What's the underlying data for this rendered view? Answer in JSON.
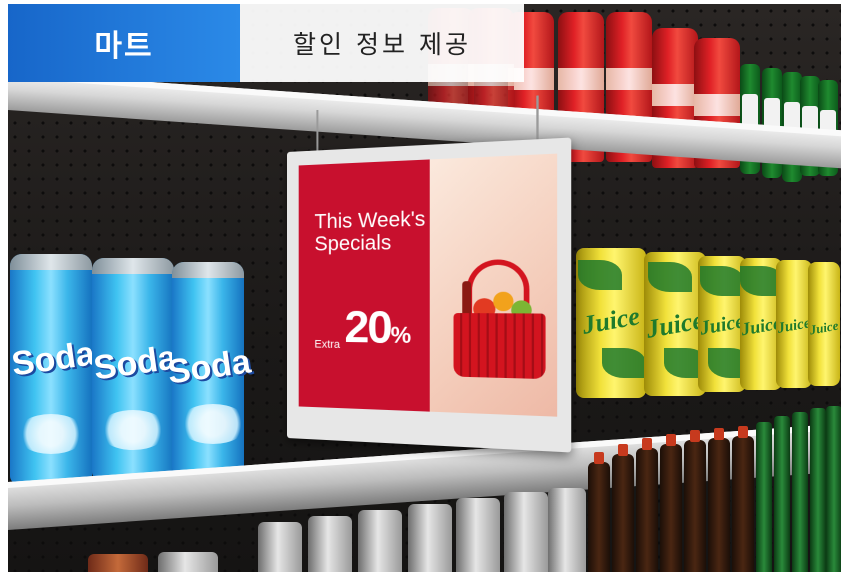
{
  "header": {
    "category_label": "마트",
    "title": "할인 정보 제공"
  },
  "signage": {
    "headline_line1": "This Week's",
    "headline_line2": "Specials",
    "extra_label": "Extra",
    "discount_value": "20",
    "discount_symbol": "%"
  },
  "products": {
    "soda_label": "Soda",
    "juice_label": "Juice"
  },
  "colors": {
    "header_blue": "#1766c9",
    "sign_red": "#c8102e",
    "header_text_dark": "#222222"
  }
}
